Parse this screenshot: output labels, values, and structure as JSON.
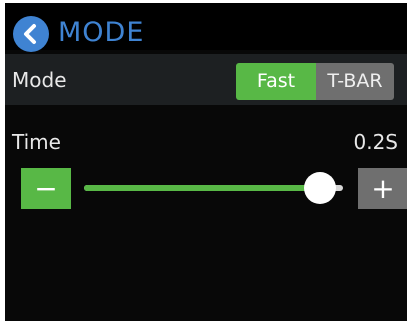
{
  "header": {
    "title": "MODE",
    "back_icon": "chevron-left-icon",
    "accent_color": "#3f83d2"
  },
  "mode": {
    "label": "Mode",
    "options": [
      "Fast",
      "T-BAR"
    ],
    "selected": "Fast",
    "selected_color": "#58b846",
    "unselected_color": "#6f6f6f"
  },
  "time": {
    "label": "Time",
    "value": "0.2S",
    "slider_fraction": 0.91,
    "minus_label": "−",
    "plus_label": "+"
  }
}
